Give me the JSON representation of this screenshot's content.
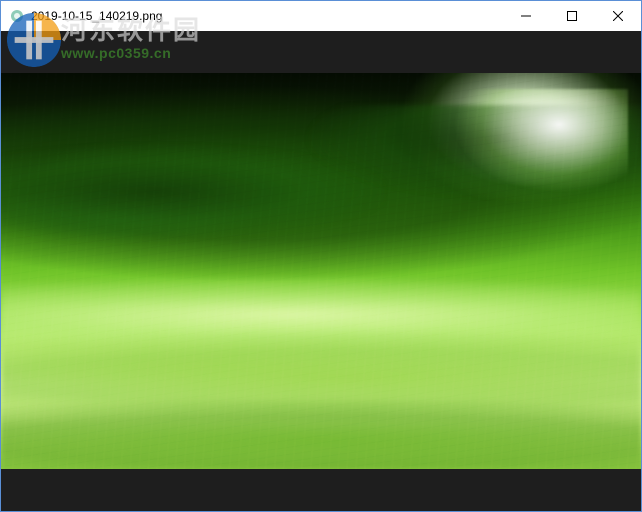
{
  "window": {
    "title": "2019-10-15_140219.png",
    "controls": {
      "minimize": "Minimize",
      "maximize": "Maximize",
      "close": "Close"
    }
  },
  "watermark": {
    "line1": "河东软件园",
    "line2": "www.pc0359.cn"
  },
  "image": {
    "description": "Abstract green landscape with glowing light upper-right, dark green clouds, flowing bright green waves"
  }
}
